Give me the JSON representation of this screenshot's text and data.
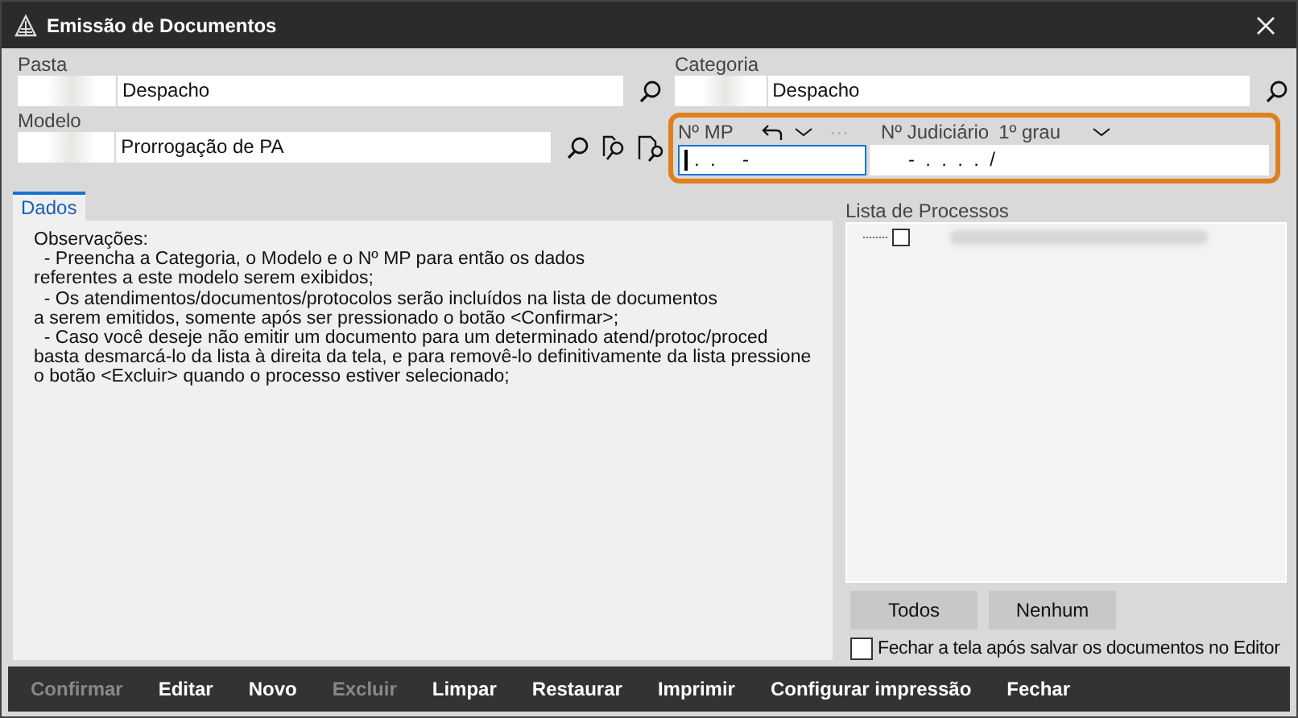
{
  "window": {
    "title": "Emissão de Documentos"
  },
  "pasta": {
    "label": "Pasta",
    "value": "Despacho"
  },
  "categoria": {
    "label": "Categoria",
    "value": "Despacho"
  },
  "modelo": {
    "label": "Modelo",
    "value": "Prorrogação de PA"
  },
  "mp": {
    "label": "Nº MP",
    "value": ".  .     -",
    "more": "···"
  },
  "judiciario": {
    "label": "Nº Judiciário",
    "grau": "1º grau",
    "value": "-  .  .  .  .  /"
  },
  "tabs": [
    {
      "label": "Dados",
      "selected": true
    }
  ],
  "observacoes": [
    "Observações:",
    "  - Preencha a Categoria, o Modelo e o Nº MP para então os dados",
    "referentes a este modelo serem exibidos;",
    "  - Os atendimentos/documentos/protocolos serão incluídos na lista de documentos",
    "a serem emitidos, somente após ser pressionado o botão <Confirmar>;",
    "  - Caso você deseje não emitir um documento para um determinado atend/protoc/proced",
    "basta desmarcá-lo da lista à direita da tela, e para removê-lo definitivamente da lista pressione",
    "o botão <Excluir> quando o processo estiver selecionado;"
  ],
  "processos": {
    "label": "Lista de Processos",
    "items": [
      {
        "checked": false
      }
    ]
  },
  "list_buttons": [
    "Todos",
    "Nenhum"
  ],
  "close_after_save": {
    "label": "Fechar a tela após salvar os documentos no Editor",
    "checked": false
  },
  "actions": [
    {
      "label": "Confirmar",
      "disabled": true
    },
    {
      "label": "Editar",
      "disabled": false
    },
    {
      "label": "Novo",
      "disabled": false
    },
    {
      "label": "Excluir",
      "disabled": true
    },
    {
      "label": "Limpar",
      "disabled": false
    },
    {
      "label": "Restaurar",
      "disabled": false
    },
    {
      "label": "Imprimir",
      "disabled": false
    },
    {
      "label": "Configurar impressão",
      "disabled": false
    },
    {
      "label": "Fechar",
      "disabled": false
    }
  ]
}
